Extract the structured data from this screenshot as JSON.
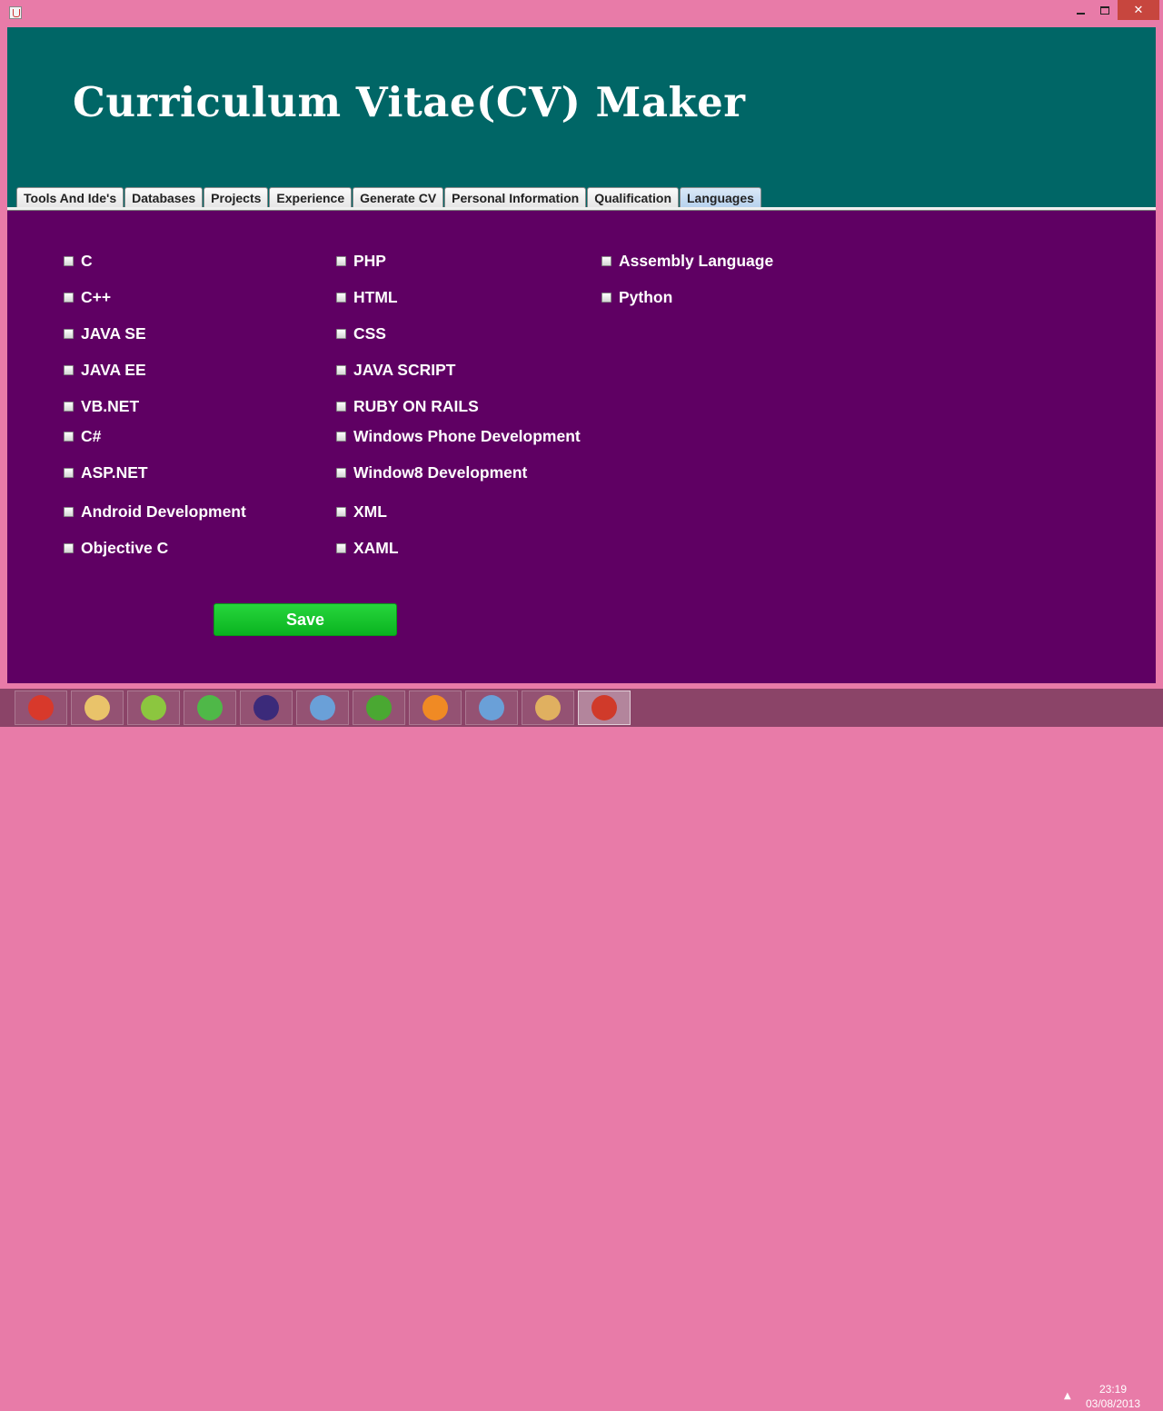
{
  "window": {
    "close_label": "✕"
  },
  "header": {
    "title": "Curriculum Vitae(CV) Maker"
  },
  "tabs": [
    {
      "label": "Tools And Ide's"
    },
    {
      "label": "Databases"
    },
    {
      "label": "Projects"
    },
    {
      "label": "Experience"
    },
    {
      "label": "Generate CV"
    },
    {
      "label": "Personal Information"
    },
    {
      "label": "Qualification"
    },
    {
      "label": "Languages",
      "active": true
    }
  ],
  "languages": {
    "col1": [
      "C",
      "C++",
      "JAVA SE",
      "JAVA EE",
      "VB.NET",
      "C#",
      "ASP.NET",
      "Android Development",
      "Objective C"
    ],
    "col2": [
      "PHP",
      "HTML",
      "CSS",
      "JAVA SCRIPT",
      "RUBY ON RAILS",
      "Windows Phone Development",
      "Window8 Development",
      "XML",
      "XAML"
    ],
    "col3": [
      "Assembly Language",
      "Python"
    ]
  },
  "save_label": "Save",
  "taskbar": {
    "apps": [
      {
        "name": "chrome-icon",
        "color": "#d8392b"
      },
      {
        "name": "file-explorer-icon",
        "color": "#e9c36a"
      },
      {
        "name": "notepad-plus-plus-icon",
        "color": "#8cc63f"
      },
      {
        "name": "dreamweaver-icon",
        "color": "#4fb848"
      },
      {
        "name": "eclipse-icon",
        "color": "#3b2a7a"
      },
      {
        "name": "virtualbox-icon",
        "color": "#6aa0d8"
      },
      {
        "name": "utorrent-icon",
        "color": "#4aa832"
      },
      {
        "name": "pdf-icon",
        "color": "#f08a24"
      },
      {
        "name": "box-icon",
        "color": "#6aa0d8"
      },
      {
        "name": "paint-icon",
        "color": "#e0b060"
      },
      {
        "name": "java-icon",
        "color": "#d03a2a"
      }
    ],
    "time": "23:19",
    "date": "03/08/2013"
  },
  "colors": {
    "header": "#006666",
    "panel": "#5f0063",
    "save": "#14c52a"
  }
}
